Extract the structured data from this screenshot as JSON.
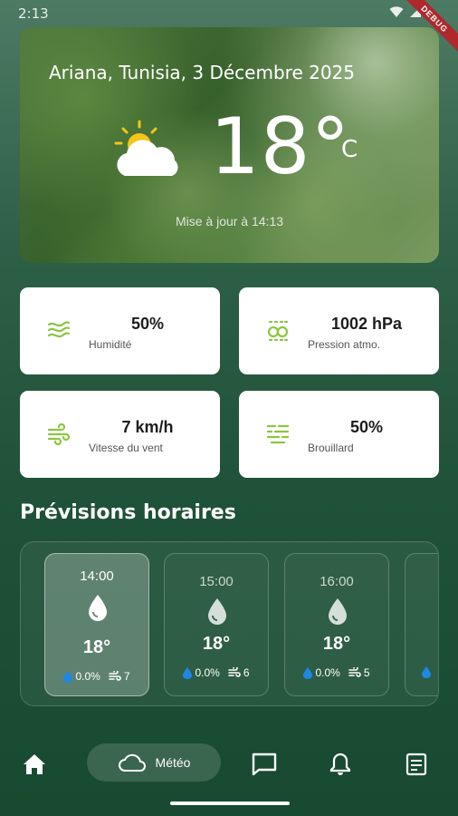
{
  "status_bar": {
    "time": "2:13",
    "debug_label": "DEBUG"
  },
  "hero": {
    "location_date": "Ariana, Tunisia, 3 Décembre 2025",
    "temperature": "18°",
    "unit": "C",
    "updated": "Mise à jour à 14:13",
    "icon": "partly-cloudy-icon"
  },
  "stats": [
    {
      "value": "50%",
      "label": "Humidité",
      "icon": "humidity-icon"
    },
    {
      "value": "1002 hPa",
      "label": "Pression atmo.",
      "icon": "pressure-icon"
    },
    {
      "value": "7 km/h",
      "label": "Vitesse du vent",
      "icon": "wind-icon"
    },
    {
      "value": "50%",
      "label": "Brouillard",
      "icon": "fog-icon"
    }
  ],
  "hourly": {
    "title": "Prévisions horaires",
    "items": [
      {
        "time": "14:00",
        "temp": "18°",
        "precip": "0.0%",
        "wind": "7"
      },
      {
        "time": "15:00",
        "temp": "18°",
        "precip": "0.0%",
        "wind": "6"
      },
      {
        "time": "16:00",
        "temp": "18°",
        "precip": "0.0%",
        "wind": "5"
      }
    ]
  },
  "nav": {
    "meteo_label": "Météo"
  },
  "colors": {
    "accent": "#8cc63f",
    "drop_blue": "#1e88e5"
  }
}
